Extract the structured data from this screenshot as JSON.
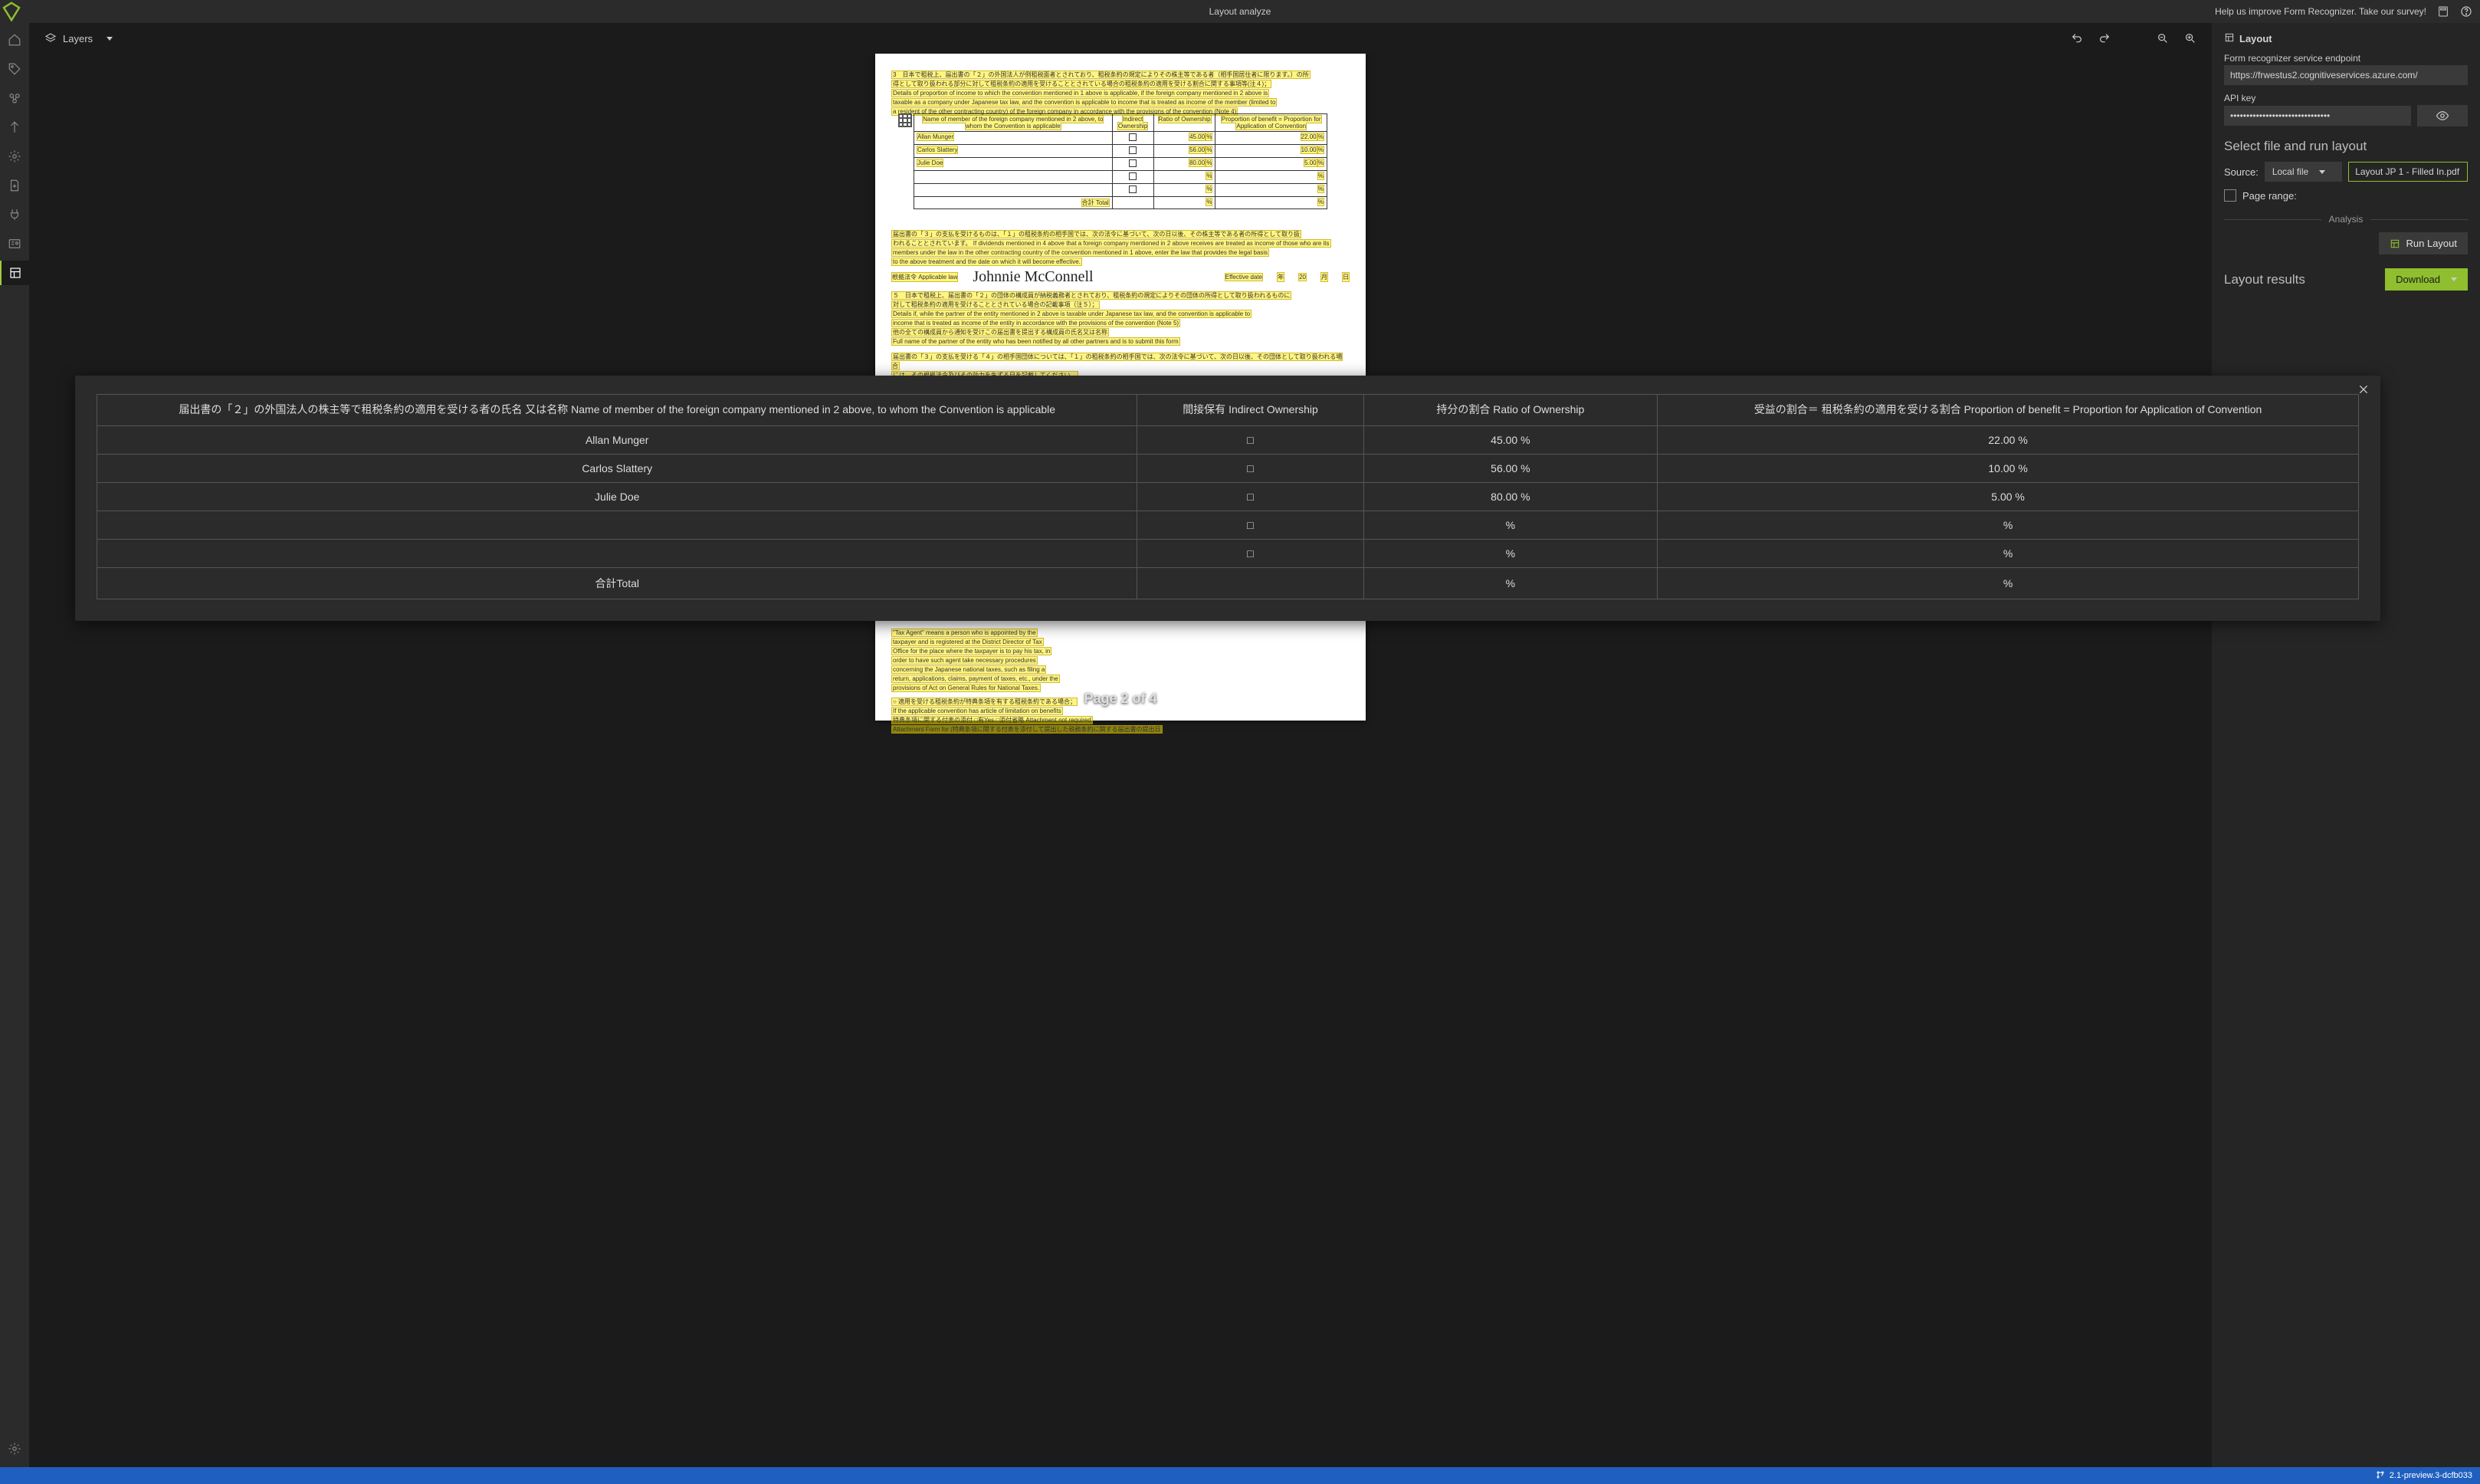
{
  "titlebar": {
    "app_title": "Layout analyze",
    "survey_text": "Help us improve Form Recognizer. Take our survey!"
  },
  "canvas_toolbar": {
    "layers_label": "Layers"
  },
  "document": {
    "page_overlay": "Page 2 of 4",
    "signature": "Johnnie McConnell",
    "effective_label": "Effective date",
    "effective_year": "20",
    "mini_table": {
      "headers": {
        "name": "Name of member of the foreign company mentioned in 2 above, to whom the Convention is applicable",
        "indirect": "Indirect Ownership",
        "ratio": "Ratio of Ownership",
        "benefit": "Proportion of benefit = Proportion for Application of Convention"
      },
      "rows": [
        {
          "name": "Allan Munger",
          "ratio": "45.00",
          "benefit": "22.00"
        },
        {
          "name": "Carlos Slattery",
          "ratio": "56.00",
          "benefit": "10.00"
        },
        {
          "name": "Julie Doe",
          "ratio": "80.00",
          "benefit": "5.00"
        }
      ],
      "total_label": "合計 Total"
    }
  },
  "rightpanel": {
    "layout_heading": "Layout",
    "endpoint_label": "Form recognizer service endpoint",
    "endpoint_value": "https://frwestus2.cognitiveservices.azure.com/",
    "apikey_label": "API key",
    "apikey_value": "•••••••••••••••••••••••••••••••",
    "selectfile_title": "Select file and run layout",
    "source_label": "Source:",
    "source_value": "Local file",
    "file_name": "Layout JP 1 - Filled In.pdf",
    "pagerange_label": "Page range:",
    "analysis_divider": "Analysis",
    "run_layout_label": "Run Layout",
    "results_title": "Layout results",
    "download_label": "Download"
  },
  "modal": {
    "headers": {
      "name": "届出書の「２」の外国法人の株主等で租税条約の適用を受ける者の氏名 又は名称 Name of member of the foreign company mentioned in 2 above, to whom the Convention is applicable",
      "indirect": "間接保有 Indirect Ownership",
      "ratio": "持分の割合 Ratio of Ownership",
      "benefit": "受益の割合＝ 租税条約の適用を受ける割合 Proportion of benefit = Proportion for Application of Convention"
    },
    "rows": [
      {
        "name": "Allan Munger",
        "indirect": "□",
        "ratio": "45.00 %",
        "benefit": "22.00 %"
      },
      {
        "name": "Carlos Slattery",
        "indirect": "□",
        "ratio": "56.00 %",
        "benefit": "10.00 %"
      },
      {
        "name": "Julie Doe",
        "indirect": "□",
        "ratio": "80.00 %",
        "benefit": "5.00 %"
      },
      {
        "name": "",
        "indirect": "□",
        "ratio": "%",
        "benefit": "%"
      },
      {
        "name": "",
        "indirect": "□",
        "ratio": "%",
        "benefit": "%"
      },
      {
        "name": "合計Total",
        "indirect": "",
        "ratio": "%",
        "benefit": "%"
      }
    ]
  },
  "statusbar": {
    "version": "2.1-preview.3-dcfb033"
  }
}
